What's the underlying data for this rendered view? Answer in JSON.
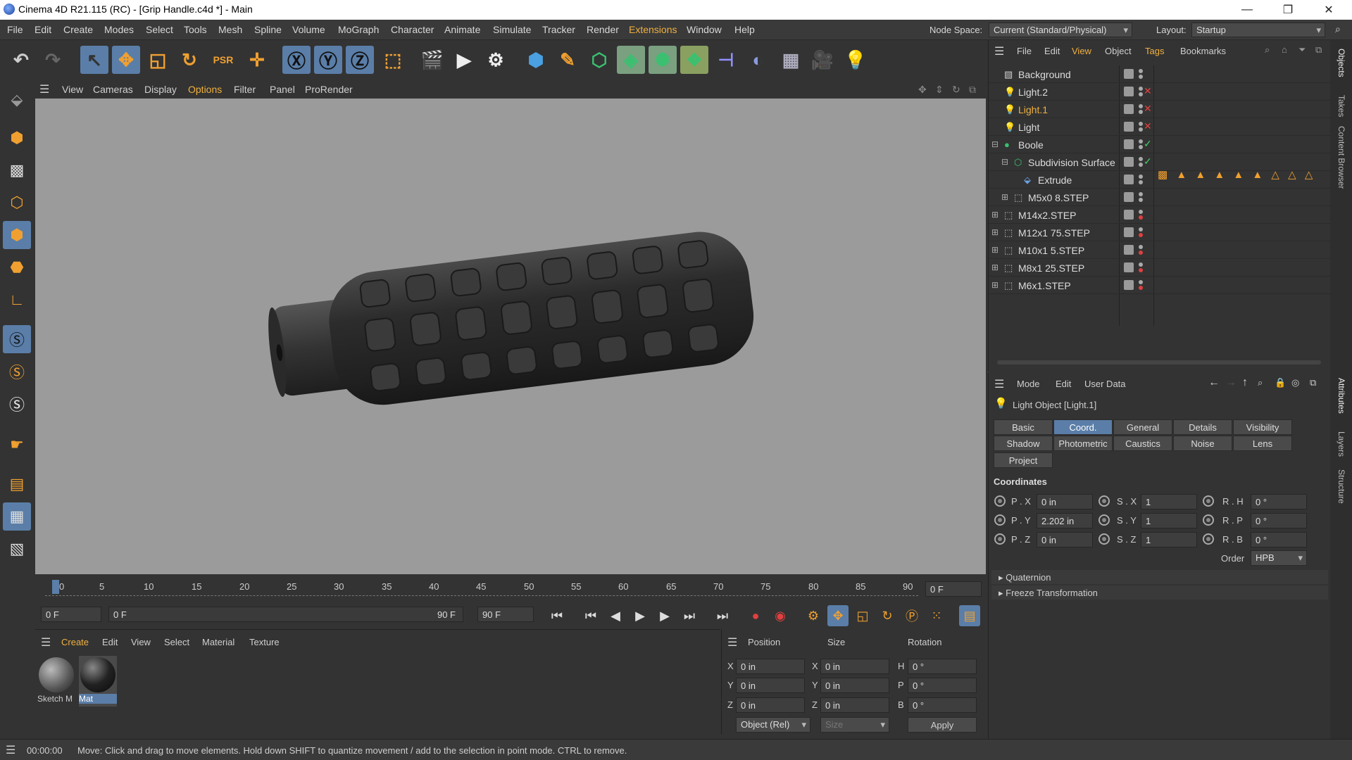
{
  "window": {
    "title": "Cinema 4D R21.115 (RC) - [Grip Handle.c4d *] - Main",
    "minimize": "—",
    "maximize": "❐",
    "close": "✕"
  },
  "menu": {
    "items": [
      "File",
      "Edit",
      "Create",
      "Modes",
      "Select",
      "Tools",
      "Mesh",
      "Spline",
      "Volume",
      "MoGraph",
      "Character",
      "Animate",
      "Simulate",
      "Tracker",
      "Render",
      "Extensions",
      "Window",
      "Help"
    ],
    "node_space_label": "Node Space:",
    "node_space_value": "Current (Standard/Physical)",
    "layout_label": "Layout:",
    "layout_value": "Startup"
  },
  "viewport_menu": {
    "items": [
      "View",
      "Cameras",
      "Display",
      "Options",
      "Filter",
      "Panel",
      "ProRender"
    ]
  },
  "timeline": {
    "ticks": [
      "0",
      "5",
      "10",
      "15",
      "20",
      "25",
      "30",
      "35",
      "40",
      "45",
      "50",
      "55",
      "60",
      "65",
      "70",
      "75",
      "80",
      "85",
      "90"
    ],
    "current_frame": "0 F"
  },
  "transport": {
    "start": "0 F",
    "range_start": "0 F",
    "range_end": "90 F",
    "end": "90 F"
  },
  "materials": {
    "menu": [
      "Create",
      "Edit",
      "View",
      "Select",
      "Material",
      "Texture"
    ],
    "items": [
      {
        "name": "Sketch M"
      },
      {
        "name": "Mat"
      }
    ]
  },
  "coords": {
    "headers": [
      "Position",
      "Size",
      "Rotation"
    ],
    "rows": [
      {
        "axis": "X",
        "pos": "0 in",
        "saxis": "X",
        "size": "0 in",
        "raxis": "H",
        "rot": "0 °"
      },
      {
        "axis": "Y",
        "pos": "0 in",
        "saxis": "Y",
        "size": "0 in",
        "raxis": "P",
        "rot": "0 °"
      },
      {
        "axis": "Z",
        "pos": "0 in",
        "saxis": "Z",
        "size": "0 in",
        "raxis": "B",
        "rot": "0 °"
      }
    ],
    "mode": "Object (Rel)",
    "size_mode": "Size",
    "apply": "Apply"
  },
  "status": {
    "time": "00:00:00",
    "message": "Move: Click and drag to move elements. Hold down SHIFT to quantize movement / add to the selection in point mode. CTRL to remove."
  },
  "objects": {
    "menu": [
      "File",
      "Edit",
      "View",
      "Object",
      "Tags",
      "Bookmarks"
    ],
    "rows": [
      {
        "name": "Background",
        "indent": 0,
        "expand": "",
        "status": "dot"
      },
      {
        "name": "Light.2",
        "indent": 0,
        "expand": "",
        "status": "x"
      },
      {
        "name": "Light.1",
        "indent": 0,
        "expand": "",
        "status": "x",
        "selected": true
      },
      {
        "name": "Light",
        "indent": 0,
        "expand": "",
        "status": "x"
      },
      {
        "name": "Boole",
        "indent": 0,
        "expand": "⊟",
        "status": "check"
      },
      {
        "name": "Subdivision Surface",
        "indent": 1,
        "expand": "⊟",
        "status": "check"
      },
      {
        "name": "Extrude",
        "indent": 2,
        "expand": "",
        "status": "dot"
      },
      {
        "name": "M5x0 8.STEP",
        "indent": 1,
        "expand": "⊞",
        "status": "dot"
      },
      {
        "name": "M14x2.STEP",
        "indent": 0,
        "expand": "⊞",
        "status": "red"
      },
      {
        "name": "M12x1 75.STEP",
        "indent": 0,
        "expand": "⊞",
        "status": "red"
      },
      {
        "name": "M10x1 5.STEP",
        "indent": 0,
        "expand": "⊞",
        "status": "red"
      },
      {
        "name": "M8x1 25.STEP",
        "indent": 0,
        "expand": "⊞",
        "status": "red"
      },
      {
        "name": "M6x1.STEP",
        "indent": 0,
        "expand": "⊞",
        "status": "red"
      }
    ]
  },
  "attributes": {
    "menu": [
      "Mode",
      "Edit",
      "User Data"
    ],
    "title": "Light Object [Light.1]",
    "tabs": [
      "Basic",
      "Coord.",
      "General",
      "Details",
      "Visibility",
      "Shadow",
      "Photometric",
      "Caustics",
      "Noise",
      "Lens",
      "Project"
    ],
    "section": "Coordinates",
    "rows": [
      {
        "p": "P . X",
        "pv": "0 in",
        "s": "S . X",
        "sv": "1",
        "r": "R . H",
        "rv": "0 °"
      },
      {
        "p": "P . Y",
        "pv": "2.202 in",
        "s": "S . Y",
        "sv": "1",
        "r": "R . P",
        "rv": "0 °"
      },
      {
        "p": "P . Z",
        "pv": "0 in",
        "s": "S . Z",
        "sv": "1",
        "r": "R . B",
        "rv": "0 °"
      }
    ],
    "order_label": "Order",
    "order_value": "HPB",
    "collapsed": [
      "Quaternion",
      "Freeze Transformation"
    ]
  },
  "side_tabs": [
    "Objects",
    "Takes",
    "Content Browser",
    "Attributes",
    "Layers",
    "Structure"
  ]
}
